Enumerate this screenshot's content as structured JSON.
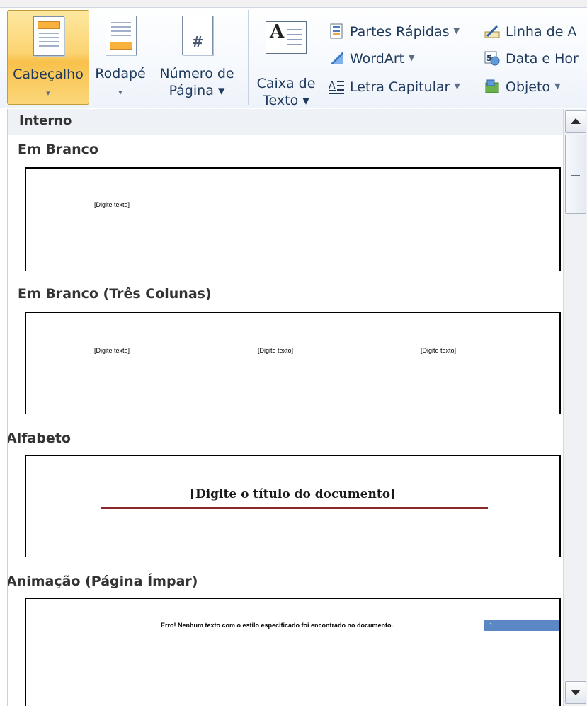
{
  "ribbon": {
    "buttons": {
      "cabecalho": {
        "label": "Cabeçalho",
        "arrow": "▾"
      },
      "rodape": {
        "label": "Rodapé",
        "arrow": "▾"
      },
      "numero": {
        "label": "Número de",
        "label2": "Página ▾"
      },
      "caixa": {
        "label": "Caixa de",
        "label2": "Texto ▾"
      }
    },
    "small": {
      "partes": "Partes Rápidas",
      "wordart": "WordArt",
      "letra": "Letra Capitular",
      "linha": "Linha de A",
      "data": "Data e Hor",
      "objeto": "Objeto"
    },
    "icons": [
      "header-doc-icon",
      "footer-doc-icon",
      "page-number-icon",
      "text-box-icon",
      "quick-parts-icon",
      "wordart-icon",
      "drop-cap-icon",
      "signature-line-icon",
      "date-time-icon",
      "object-icon"
    ],
    "accent": "#f8c14b"
  },
  "gallery": {
    "category": "Interno",
    "items": [
      {
        "label": "Em Branco",
        "placeholder": "[Digite texto]"
      },
      {
        "label": "Em Branco (Três Colunas)",
        "placeholders": [
          "[Digite texto]",
          "[Digite texto]",
          "[Digite texto]"
        ]
      },
      {
        "label": "Alfabeto",
        "title": "[Digite o título do documento]"
      },
      {
        "label": "Animação (Página Ímpar)",
        "text": "Erro! Nenhum texto com o estilo especificado foi encontrado no documento.",
        "page": "1"
      }
    ]
  }
}
